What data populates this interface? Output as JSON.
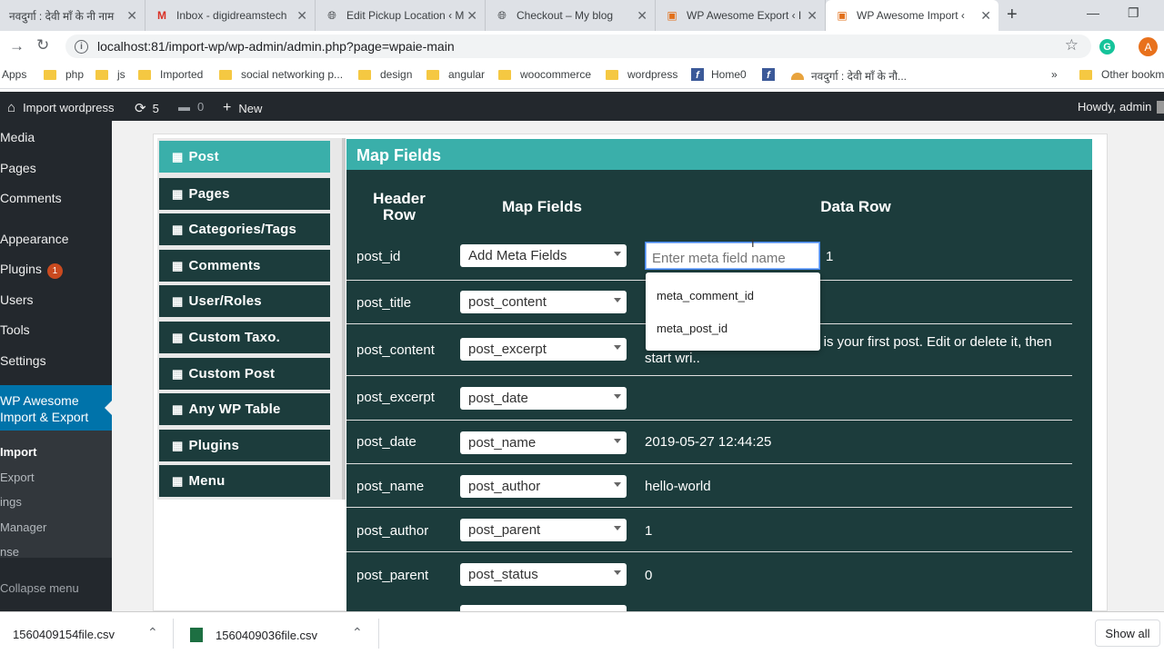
{
  "browser": {
    "tabs": [
      {
        "title": "नवदुर्गा : देवी माँ के नी नाम",
        "icon": "doc-icon"
      },
      {
        "title": "Inbox - digidreamstech",
        "icon": "gmail-icon"
      },
      {
        "title": "Edit Pickup Location ‹ M",
        "icon": "wordpress-icon"
      },
      {
        "title": "Checkout – My blog",
        "icon": "wordpress-icon"
      },
      {
        "title": "WP Awesome Export ‹ I",
        "icon": "plugin-icon"
      },
      {
        "title": "WP Awesome Import ‹",
        "icon": "plugin-icon"
      }
    ],
    "url": "localhost:81/import-wp/wp-admin/admin.php?page=wpaie-main",
    "avatar_letter": "A",
    "bookmarks": [
      "Apps",
      "php",
      "js",
      "Imported",
      "social networking p...",
      "design",
      "angular",
      "woocommerce",
      "wordpress",
      "Home0",
      "",
      "नवदुर्गा : देवी माँ के नौ...",
      "»",
      "Other bookm"
    ]
  },
  "adminbar": {
    "site": "Import wordpress",
    "updates": "5",
    "comments": "0",
    "new": "New",
    "howdy": "Howdy, admin"
  },
  "wp_menu": {
    "items": [
      "Media",
      "Pages",
      "Comments",
      "Appearance",
      "Plugins",
      "Users",
      "Tools",
      "Settings"
    ],
    "plugins_badge": "1",
    "active": "WP Awesome Import & Export",
    "submenu": [
      "Import",
      "Export",
      "ings",
      "Manager",
      "nse"
    ],
    "collapse": "Collapse menu"
  },
  "plugin_nav": [
    "Post",
    "Pages",
    "Categories/Tags",
    "Comments",
    "User/Roles",
    "Custom Taxo.",
    "Custom Post",
    "Any WP Table",
    "Plugins",
    "Menu"
  ],
  "map": {
    "title": "Map Fields",
    "col_header_row": "Header Row",
    "col_map_fields": "Map Fields",
    "col_data_row": "Data Row",
    "meta_placeholder": "Enter meta field name",
    "meta_dropdown": [
      "meta_comment_id",
      "meta_post_id"
    ],
    "rows": [
      {
        "header": "post_id",
        "select": "Add Meta Fields",
        "data": "1"
      },
      {
        "header": "post_title",
        "select": "post_content",
        "data": ""
      },
      {
        "header": "post_content",
        "select": "post_excerpt",
        "data": "s is your first post. Edit or delete it, then start wri.."
      },
      {
        "header": "post_excerpt",
        "select": "post_date",
        "data": ""
      },
      {
        "header": "post_date",
        "select": "post_name",
        "data": "2019-05-27 12:44:25"
      },
      {
        "header": "post_name",
        "select": "post_author",
        "data": "hello-world"
      },
      {
        "header": "post_author",
        "select": "post_parent",
        "data": "1"
      },
      {
        "header": "post_parent",
        "select": "post_status",
        "data": "0"
      }
    ]
  },
  "downloads": {
    "files": [
      "1560409154file.csv",
      "1560409036file.csv"
    ],
    "show_all": "Show all"
  }
}
